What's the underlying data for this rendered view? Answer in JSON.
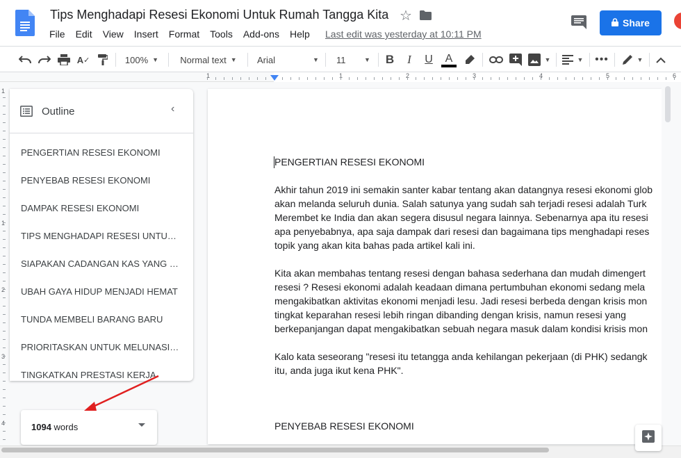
{
  "doc": {
    "title": "Tips Menghadapi Resesi Ekonomi Untuk Rumah Tangga Kita",
    "last_edit": "Last edit was yesterday at 10:11 PM"
  },
  "menu": [
    "File",
    "Edit",
    "View",
    "Insert",
    "Format",
    "Tools",
    "Add-ons",
    "Help"
  ],
  "share_label": "Share",
  "toolbar": {
    "zoom": "100%",
    "style": "Normal text",
    "font": "Arial",
    "size": "11"
  },
  "ruler": {
    "h_numbers": [
      "1",
      "1",
      "2",
      "3",
      "4",
      "5",
      "6"
    ],
    "v_numbers": [
      "1",
      "1",
      "2",
      "3",
      "4"
    ]
  },
  "outline": {
    "title": "Outline",
    "items": [
      "PENGERTIAN RESESI EKONOMI",
      "PENYEBAB RESESI EKONOMI",
      "DAMPAK RESESI EKONOMI",
      "TIPS MENGHADAPI RESESI UNTUK RUMAH TANGGA",
      "SIAPAKAN CADANGAN KAS YANG CUKUP",
      "UBAH GAYA HIDUP MENJADI HEMAT",
      "TUNDA MEMBELI BARANG BARU",
      "PRIORITASKAN UNTUK MELUNASI HUTANG",
      "TINGKATKAN PRESTASI KERJA"
    ]
  },
  "word_count": {
    "number": "1094",
    "unit": "words"
  },
  "content": {
    "heading1": "PENGERTIAN RESESI EKONOMI",
    "p1": [
      "Akhir tahun 2019 ini semakin santer kabar tentang akan datangnya resesi ekonomi glob",
      "akan melanda seluruh dunia. Salah satunya yang sudah sah terjadi resesi adalah Turk",
      "Merembet ke India dan akan segera disusul negara lainnya. Sebenarnya apa itu resesi",
      "apa penyebabnya, apa saja dampak dari resesi dan bagaimana tips menghadapi reses",
      "topik yang akan kita bahas pada artikel kali ini."
    ],
    "p2": [
      "Kita akan membahas tentang resesi dengan bahasa sederhana dan mudah dimengert",
      "resesi ? Resesi ekonomi adalah keadaan dimana pertumbuhan ekonomi sedang mela",
      "mengakibatkan aktivitas ekonomi menjadi lesu. Jadi resesi berbeda dengan krisis mon",
      "tingkat keparahan resesi lebih ringan dibanding dengan krisis, namun resesi yang",
      "berkepanjangan dapat mengakibatkan sebuah negara masuk dalam kondisi krisis mon"
    ],
    "p3": [
      "Kalo kata seseorang \"resesi itu tetangga anda kehilangan pekerjaan (di PHK) sedangk",
      "itu, anda juga ikut kena PHK\"."
    ],
    "heading2": "PENYEBAB RESESI EKONOMI"
  },
  "colors": {
    "accent": "#1a73e8",
    "annotation_arrow": "#e02020"
  }
}
